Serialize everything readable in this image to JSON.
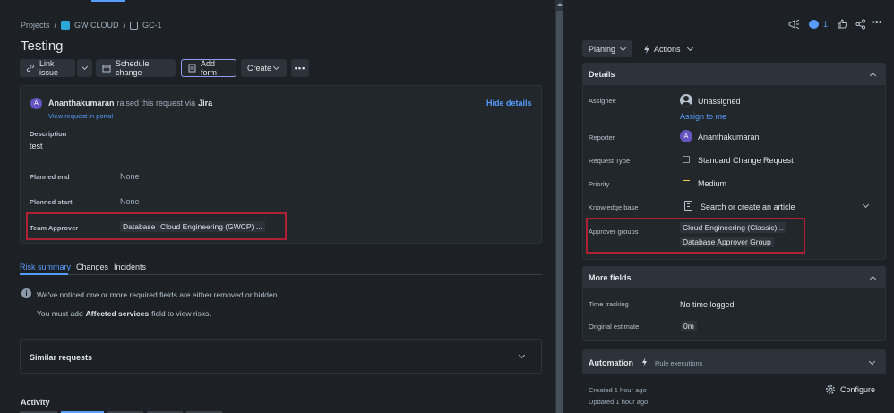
{
  "breadcrumb": {
    "projects": "Projects",
    "sep1": "/",
    "project": "GW CLOUD",
    "sep2": "/",
    "issue": "GC-1"
  },
  "issue_title": "Testing",
  "toolbar": {
    "link_issue": "Link issue",
    "schedule_change": "Schedule change",
    "add_form": "Add form",
    "create": "Create"
  },
  "request": {
    "author": "Ananthakumaran",
    "raised_via_text": "raised this request via",
    "channel": "Jira",
    "view_portal": "View request in portal",
    "hide_details": "Hide details",
    "avatar_letter": "A"
  },
  "fields": {
    "description_label": "Description",
    "description_value": "test",
    "planned_end_label": "Planned end",
    "planned_end_value": "None",
    "planned_start_label": "Planned start",
    "planned_start_value": "None",
    "team_approver_label": "Team Approver",
    "team_approver_values": [
      "Database",
      "Cloud Engineering (GWCP) ..."
    ]
  },
  "tabs": [
    "Risk summary",
    "Changes",
    "Incidents"
  ],
  "risk": {
    "notice": "We've noticed one or more required fields are either removed or hidden.",
    "must_prefix": "You must add",
    "must_field": "Affected services",
    "must_suffix": "field to view risks."
  },
  "similar_requests": "Similar requests",
  "activity": "Activity",
  "top_right": {
    "watch_count": "1"
  },
  "status_button": "Planing",
  "actions_button": "Actions",
  "details": {
    "title": "Details",
    "assignee_label": "Assignee",
    "assignee_value": "Unassigned",
    "assign_to_me": "Assign to me",
    "reporter_label": "Reporter",
    "reporter_value": "Ananthakumaran",
    "request_type_label": "Request Type",
    "request_type_value": "Standard Change Request",
    "priority_label": "Priority",
    "priority_value": "Medium",
    "kb_label": "Knowledge base",
    "kb_value": "Search or create an article",
    "approver_groups_label": "Approver groups",
    "approver_groups": [
      "Cloud Engineering (Classic)...",
      "Database Approver Group"
    ]
  },
  "more_fields": {
    "title": "More fields",
    "time_tracking_label": "Time tracking",
    "time_tracking_value": "No time logged",
    "original_estimate_label": "Original estimate",
    "original_estimate_value": "0m"
  },
  "automation": {
    "title": "Automation",
    "rule_executions": "Rule executions"
  },
  "footer": {
    "created": "Created 1 hour ago",
    "updated": "Updated 1 hour ago",
    "configure": "Configure"
  },
  "colors": {
    "accent": "#579dff",
    "highlight": "#b02034",
    "priority": "#f5cd47",
    "avatar": "#6554c0"
  }
}
